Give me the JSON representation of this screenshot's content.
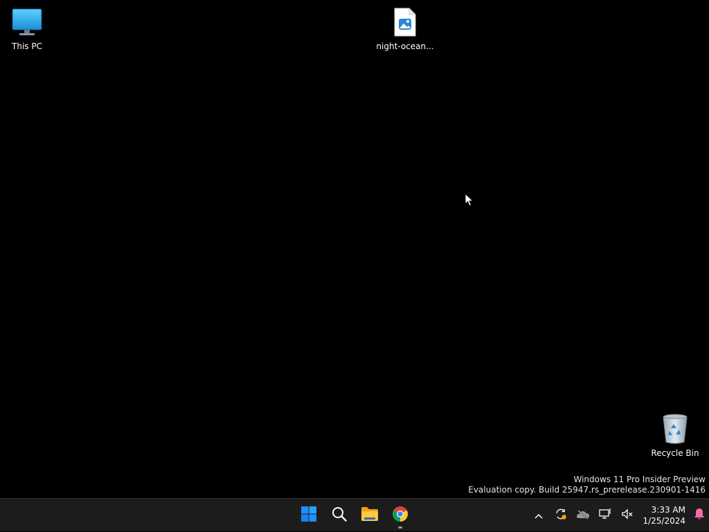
{
  "desktop": {
    "icons": [
      {
        "label": "This PC",
        "icon": "monitor-icon"
      },
      {
        "label": "night-ocean...",
        "icon": "image-file-icon"
      },
      {
        "label": "Recycle Bin",
        "icon": "recycle-bin-icon"
      }
    ],
    "watermark": {
      "line1": "Windows 11 Pro Insider Preview",
      "line2": "Evaluation copy. Build 25947.rs_prerelease.230901-1416"
    }
  },
  "taskbar": {
    "apps": [
      {
        "name": "Start",
        "icon": "windows-start-icon"
      },
      {
        "name": "Search",
        "icon": "search-icon"
      },
      {
        "name": "File Explorer",
        "icon": "folder-icon"
      },
      {
        "name": "Google Chrome",
        "icon": "chrome-icon",
        "running": true
      }
    ],
    "tray": {
      "icons": [
        "chevron-up-icon",
        "sync-icon",
        "onedrive-icon",
        "network-icon",
        "volume-muted-icon"
      ],
      "time": "3:33 AM",
      "date": "1/25/2024",
      "notification_icon": "bell-icon"
    }
  },
  "colors": {
    "background": "#000000",
    "taskbar": "#1c1c1c",
    "windows_blue": "#1e90ff"
  }
}
